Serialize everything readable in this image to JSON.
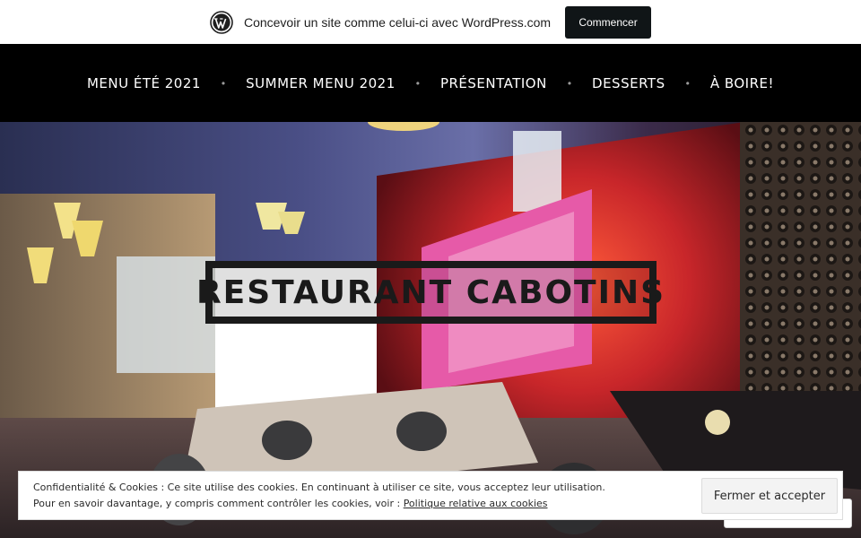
{
  "wp_bar": {
    "text": "Concevoir un site comme celui-ci avec WordPress.com",
    "cta": "Commencer"
  },
  "nav": {
    "items": [
      {
        "label": "MENU ÉTÉ 2021"
      },
      {
        "label": "SUMMER MENU 2021"
      },
      {
        "label": "PRÉSENTATION"
      },
      {
        "label": "DESSERTS"
      },
      {
        "label": "À BOIRE!"
      }
    ],
    "separator": "•"
  },
  "hero": {
    "title": "RESTAURANT CABOTINS"
  },
  "cookie": {
    "line1": "Confidentialité & Cookies : Ce site utilise des cookies. En continuant à utiliser ce site, vous acceptez leur utilisation.",
    "line2": "Pour en savoir davantage, y compris comment contrôler les cookies, voir : ",
    "link": "Politique relative aux cookies",
    "button": "Fermer et accepter"
  },
  "colors": {
    "nav_bg": "#000000",
    "wp_button_bg": "#101517",
    "title_color": "#1a1a1a"
  },
  "icons": {
    "wp_logo": "wordpress-logo-icon"
  }
}
